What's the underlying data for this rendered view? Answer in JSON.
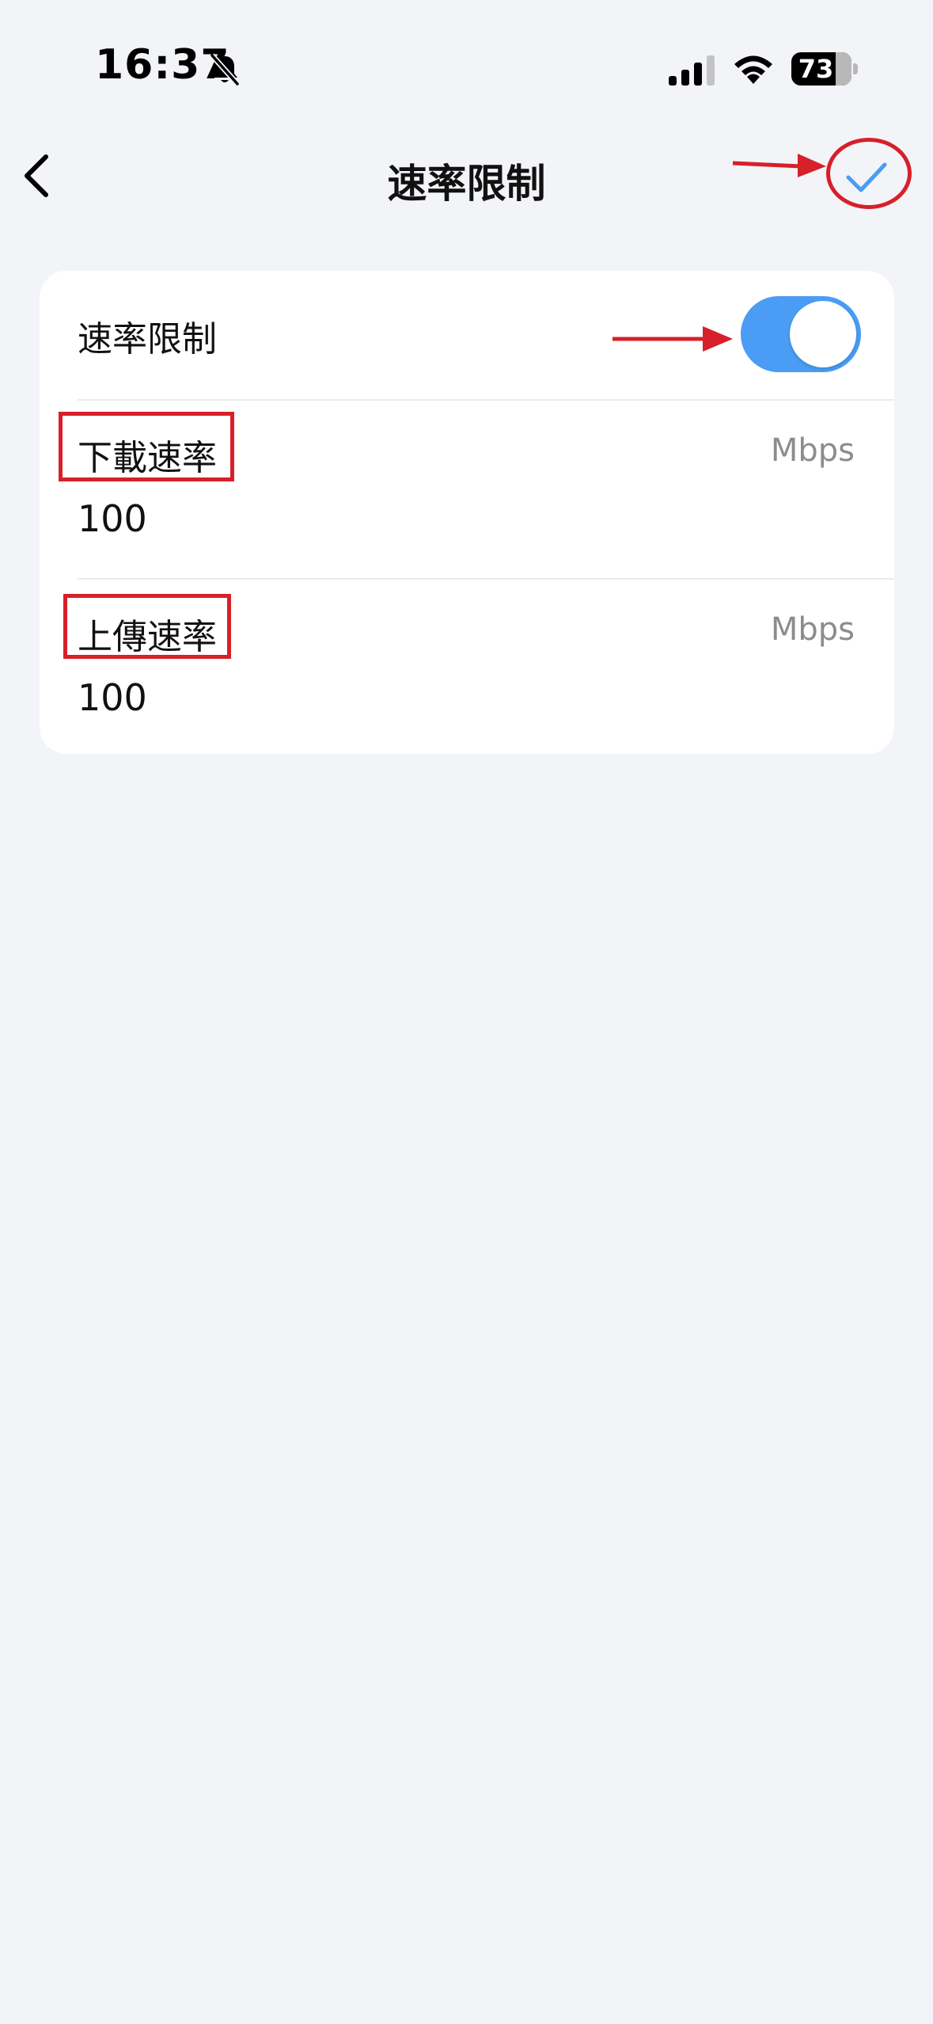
{
  "status_bar": {
    "time": "16:37",
    "battery": "73",
    "icons": [
      "bell-slash-icon",
      "cellular-signal-icon",
      "wifi-icon",
      "battery-icon"
    ]
  },
  "nav": {
    "title": "速率限制",
    "back_icon": "chevron-left-icon",
    "confirm_icon": "checkmark-icon"
  },
  "settings": {
    "toggle_label": "速率限制",
    "toggle_on": true,
    "download": {
      "label": "下載速率",
      "unit": "Mbps",
      "value": "100"
    },
    "upload": {
      "label": "上傳速率",
      "unit": "Mbps",
      "value": "100"
    }
  },
  "colors": {
    "background": "#f3f4f8",
    "accent": "#4a9cf4",
    "annotation": "#d6202a"
  }
}
